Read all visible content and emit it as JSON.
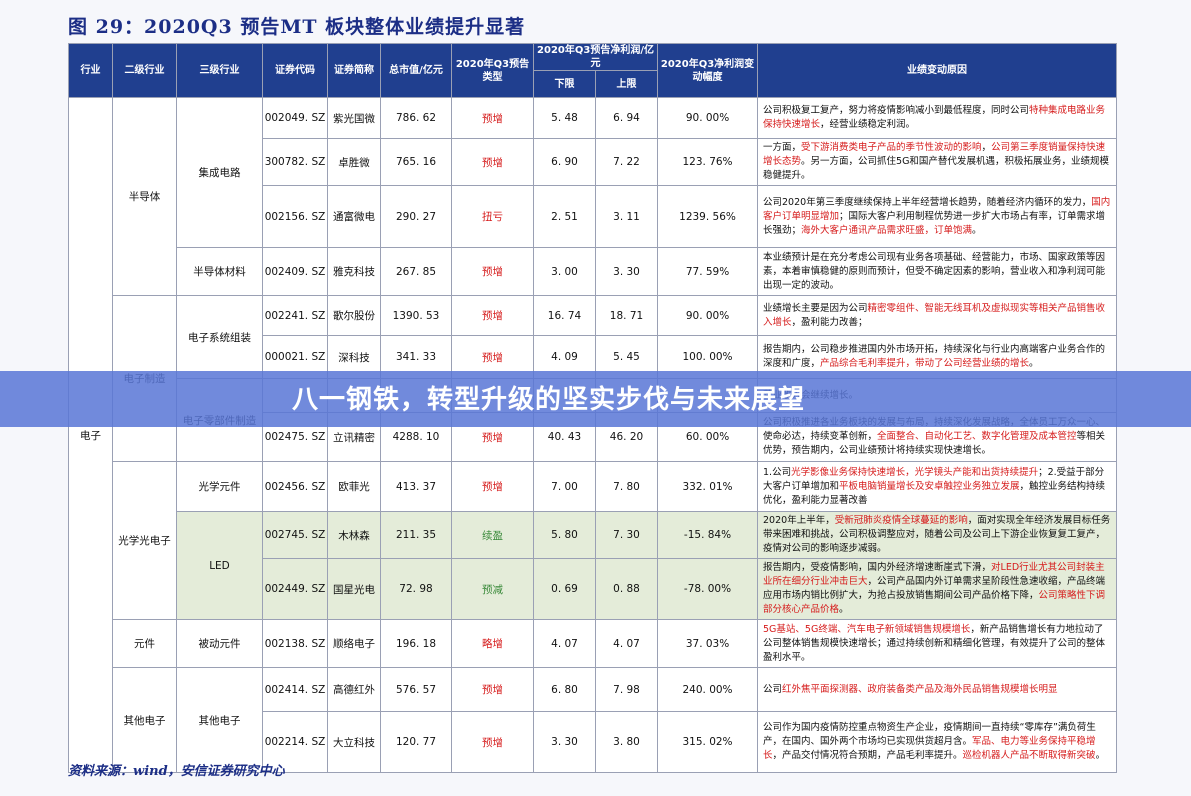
{
  "figure_title": "图 29：2020Q3 预告MT 板块整体业绩提升显著",
  "source": "资料来源：wind，安信证券研究中心",
  "banner_text": "八一钢铁，转型升级的坚实步伐与未来展望",
  "headers": {
    "industry": "行业",
    "level2": "二级行业",
    "level3": "三级行业",
    "code": "证券代码",
    "name": "证券简称",
    "mktcap": "总市值/亿元",
    "ftype": "2020年Q3预告类型",
    "profit": "2020年Q3预告净利润/亿元",
    "low": "下限",
    "high": "上限",
    "growth": "2020年Q3净利润变动幅度",
    "reason": "业绩变动原因"
  },
  "groups": {
    "industry": "电子",
    "semi": "半导体",
    "emfg": "电子制造",
    "opto": "光学光电子",
    "comp": "元件",
    "other": "其他电子",
    "ic": "集成电路",
    "semimat": "半导体材料",
    "esys": "电子系统组装",
    "eparts": "电子零部件制造",
    "optcomp": "光学元件",
    "led": "LED",
    "passive": "被动元件",
    "other3": "其他电子"
  },
  "rows": [
    {
      "code": "002049. SZ",
      "name": "紫光国微",
      "cap": "786. 62",
      "type": "预增",
      "low": "5. 48",
      "high": "6. 94",
      "chg": "90. 00%",
      "reason": [
        {
          "t": "公司积极复工复产，努力将疫情影响减小到最低程度，同时公司"
        },
        {
          "t": "特种集成电路业务保持快速增长",
          "h": true
        },
        {
          "t": "，经营业绩稳定利润。"
        }
      ]
    },
    {
      "code": "300782. SZ",
      "name": "卓胜微",
      "cap": "765. 16",
      "type": "预增",
      "low": "6. 90",
      "high": "7. 22",
      "chg": "123. 76%",
      "reason": [
        {
          "t": "一方面，"
        },
        {
          "t": "受下游消费类电子产品的季节性波动的影响",
          "h": true
        },
        {
          "t": "，"
        },
        {
          "t": "公司第三季度销量保持快速增长态势",
          "h": true
        },
        {
          "t": "。另一方面，公司抓住5G和国产替代发展机遇，积极拓展业务，业绩规模稳健提升。"
        }
      ]
    },
    {
      "code": "002156. SZ",
      "name": "通富微电",
      "cap": "290. 27",
      "type": "扭亏",
      "low": "2. 51",
      "high": "3. 11",
      "chg": "1239. 56%",
      "reason": [
        {
          "t": "公司2020年第三季度继续保持上半年经营增长趋势，随着经济内循环的发力，"
        },
        {
          "t": "国内客户订单明显增加",
          "h": true
        },
        {
          "t": "；国际大客户利用制程优势进一步扩大市场占有率，订单需求增长强劲；"
        },
        {
          "t": "海外大客户通讯产品需求旺盛，订单饱满",
          "h": true
        },
        {
          "t": "。"
        }
      ]
    },
    {
      "code": "002409. SZ",
      "name": "雅克科技",
      "cap": "267. 85",
      "type": "预增",
      "low": "3. 00",
      "high": "3. 30",
      "chg": "77. 59%",
      "reason": [
        {
          "t": "本业绩预计是在充分考虑公司现有业务各项基础、经营能力，市场、国家政策等因素，本着审慎稳健的原则而预计，但受不确定因素的影响，营业收入和净利润可能出现一定的波动。"
        }
      ]
    },
    {
      "code": "002241. SZ",
      "name": "歌尔股份",
      "cap": "1390. 53",
      "type": "预增",
      "low": "16. 74",
      "high": "18. 71",
      "chg": "90. 00%",
      "reason": [
        {
          "t": "业绩增长主要是因为公司"
        },
        {
          "t": "精密零组件、智能无线耳机及虚拟现实等相关产品销售收入增长",
          "h": true
        },
        {
          "t": "，盈利能力改善；"
        }
      ]
    },
    {
      "code": "000021. SZ",
      "name": "深科技",
      "cap": "341. 33",
      "type": "预增",
      "low": "4. 09",
      "high": "5. 45",
      "chg": "100. 00%",
      "reason": [
        {
          "t": "报告期内，公司稳步推进国内外市场开拓，持续深化与行业内高端客户业务合作的深度和广度，"
        },
        {
          "t": "产品综合毛利率提升，带动了公司经营业绩的增长",
          "h": true
        },
        {
          "t": "。"
        }
      ]
    },
    {
      "code": "",
      "name": "",
      "cap": "",
      "type": "",
      "low": "",
      "high": "",
      "chg": "",
      "reason": [
        {
          "t": "营业收入会继续增长。"
        }
      ]
    },
    {
      "code": "002475. SZ",
      "name": "立讯精密",
      "cap": "4288. 10",
      "type": "预增",
      "low": "40. 43",
      "high": "46. 20",
      "chg": "60. 00%",
      "reason": [
        {
          "t": "公司积极推进各业务板块的发展与布局，持续深化发展战略，全体员工万众一心、使命必达，持续变革创新，"
        },
        {
          "t": "全面整合、自动化工艺、数字化管理及成本管控",
          "h": true
        },
        {
          "t": "等相关优势，预告期内，公司业绩预计将持续实现快速增长。"
        }
      ]
    },
    {
      "code": "002456. SZ",
      "name": "欧菲光",
      "cap": "413. 37",
      "type": "预增",
      "low": "7. 00",
      "high": "7. 80",
      "chg": "332. 01%",
      "reason": [
        {
          "t": "1.公司"
        },
        {
          "t": "光学影像业务保持快速增长，光学镜头产能和出货持续提升",
          "h": true
        },
        {
          "t": "；2.受益于部分大客户订单增加和"
        },
        {
          "t": "平板电脑销量增长及安卓触控业务独立发展",
          "h": true
        },
        {
          "t": "，触控业务结构持续优化，盈利能力显著改善"
        }
      ]
    },
    {
      "code": "002745. SZ",
      "name": "木林森",
      "cap": "211. 35",
      "type": "续盈",
      "low": "5. 80",
      "high": "7. 30",
      "chg": "-15. 84%",
      "reason": [
        {
          "t": "2020年上半年，"
        },
        {
          "t": "受新冠肺炎疫情全球蔓延的影响",
          "h": true
        },
        {
          "t": "，面对实现全年经济发展目标任务带来困难和挑战，公司积极调整应对，随着公司及公司上下游企业恢复复工复产，疫情对公司的影响逐步减弱。"
        }
      ]
    },
    {
      "code": "002449. SZ",
      "name": "国星光电",
      "cap": "72. 98",
      "type": "预减",
      "low": "0. 69",
      "high": "0. 88",
      "chg": "-78. 00%",
      "reason": [
        {
          "t": "报告期内，受疫情影响，国内外经济增速断崖式下滑，"
        },
        {
          "t": "对LED行业尤其公司封装主业所在细分行业冲击巨大",
          "h": true
        },
        {
          "t": "，公司产品国内外订单需求呈阶段性急速收缩，产品终端应用市场内销比例扩大，为抢占投放销售期间公司产品价格下降，"
        },
        {
          "t": "公司策略性下调部分核心产品价格",
          "h": true
        },
        {
          "t": "。"
        }
      ]
    },
    {
      "code": "002138. SZ",
      "name": "顺络电子",
      "cap": "196. 18",
      "type": "略增",
      "low": "4. 07",
      "high": "4. 07",
      "chg": "37. 03%",
      "reason": [
        {
          "t": "5G基站、5G终端、汽车电子新领域销售规模增长",
          "h": true
        },
        {
          "t": "，新产品销售增长有力地拉动了公司整体销售规模快速增长；通过持续创新和精细化管理，有效提升了公司的整体盈利水平。"
        }
      ]
    },
    {
      "code": "002414. SZ",
      "name": "高德红外",
      "cap": "576. 57",
      "type": "预增",
      "low": "6. 80",
      "high": "7. 98",
      "chg": "240. 00%",
      "reason": [
        {
          "t": "公司"
        },
        {
          "t": "红外焦平面探测器、政府装备类产品及海外民品销售规模增长明显",
          "h": true
        }
      ]
    },
    {
      "code": "002214. SZ",
      "name": "大立科技",
      "cap": "120. 77",
      "type": "预增",
      "low": "3. 30",
      "high": "3. 80",
      "chg": "315. 02%",
      "reason": [
        {
          "t": "公司作为国内疫情防控重点物资生产企业，疫情期间一直持续“零库存”满负荷生产，在国内、国外两个市场均已实现供货超月含。"
        },
        {
          "t": "军品、电力等业务保持平稳增长",
          "h": true
        },
        {
          "t": "，产品交付情况符合预期，产品毛利率提升。"
        },
        {
          "t": "巡检机器人产品不断取得新突破",
          "h": true
        },
        {
          "t": "。"
        }
      ]
    }
  ],
  "colors": {
    "header_bg": "#203f8f",
    "highlight": "#d61c1c",
    "led_bg": "#e4ecd9",
    "banner": "#5876d6"
  }
}
